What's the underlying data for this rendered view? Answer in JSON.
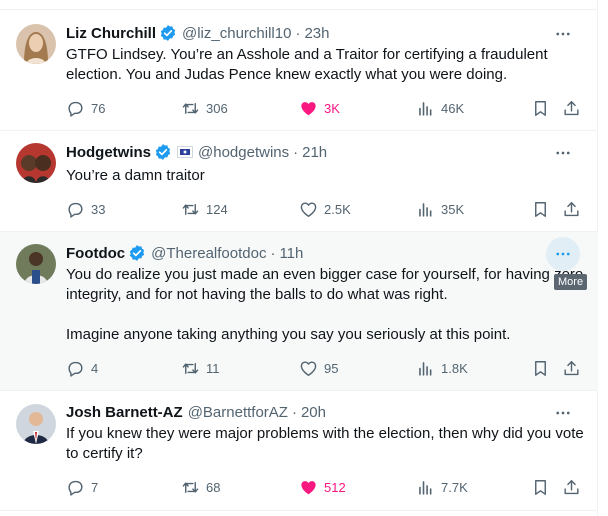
{
  "tooltip": "More",
  "tweets": [
    {
      "name": "Liz Churchill",
      "handle": "@liz_churchill10",
      "time": "23h",
      "text": [
        "GTFO Lindsey. You’re an Asshole and a Traitor for certifying a fraudulent election. You and Judas Pence knew exactly what you were doing."
      ],
      "replies": "76",
      "reposts": "306",
      "likes": "3K",
      "views": "46K",
      "liked": true
    },
    {
      "name": "Hodgetwins",
      "handle": "@hodgetwins",
      "time": "21h",
      "text": [
        "You’re a damn traitor"
      ],
      "replies": "33",
      "reposts": "124",
      "likes": "2.5K",
      "views": "35K",
      "liked": false
    },
    {
      "name": "Footdoc",
      "handle": "@Therealfootdoc",
      "time": "11h",
      "text": [
        "You do realize you just made an even bigger case for yourself, for having zero integrity, and for not having the balls to do what was right.",
        "Imagine anyone taking anything you say you seriously at this point."
      ],
      "replies": "4",
      "reposts": "11",
      "likes": "95",
      "views": "1.8K",
      "liked": false
    },
    {
      "name": "Josh Barnett-AZ",
      "handle": "@BarnettforAZ",
      "time": "20h",
      "text": [
        "If you knew they were major problems with the election, then why did you vote to certify it?"
      ],
      "replies": "7",
      "reposts": "68",
      "likes": "512",
      "views": "7.7K",
      "liked": true
    }
  ],
  "colors": {
    "like": "#f91880",
    "muted": "#536471",
    "verified": "#1d9bf0",
    "hover_bg": "#f7f9f9"
  }
}
